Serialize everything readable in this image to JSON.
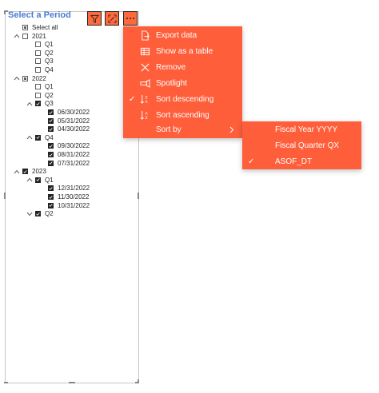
{
  "slicer": {
    "title": "Select a Period",
    "select_all": "Select all",
    "years": [
      {
        "label": "2021",
        "state": "unchecked",
        "expanded": true,
        "quarters": [
          {
            "label": "Q1",
            "state": "unchecked",
            "dates": []
          },
          {
            "label": "Q2",
            "state": "unchecked",
            "dates": []
          },
          {
            "label": "Q3",
            "state": "unchecked",
            "dates": []
          },
          {
            "label": "Q4",
            "state": "unchecked",
            "dates": []
          }
        ]
      },
      {
        "label": "2022",
        "state": "partial",
        "expanded": true,
        "quarters": [
          {
            "label": "Q1",
            "state": "unchecked",
            "dates": []
          },
          {
            "label": "Q2",
            "state": "unchecked",
            "dates": []
          },
          {
            "label": "Q3",
            "state": "checked",
            "expanded": true,
            "dates": [
              "06/30/2022",
              "05/31/2022",
              "04/30/2022"
            ]
          },
          {
            "label": "Q4",
            "state": "checked",
            "expanded": true,
            "dates": [
              "09/30/2022",
              "08/31/2022",
              "07/31/2022"
            ]
          }
        ]
      },
      {
        "label": "2023",
        "state": "checked",
        "expanded": true,
        "quarters": [
          {
            "label": "Q1",
            "state": "checked",
            "expanded": true,
            "dates": [
              "12/31/2022",
              "11/30/2022",
              "10/31/2022"
            ]
          },
          {
            "label": "Q2",
            "state": "checked",
            "expanded": false,
            "dates": []
          }
        ]
      }
    ]
  },
  "header_buttons": [
    {
      "icon": "filter-icon"
    },
    {
      "icon": "focus-mode-icon"
    },
    {
      "icon": "more-options-icon"
    }
  ],
  "context_menu": {
    "items": [
      {
        "label": "Export data",
        "icon": "export-data-icon",
        "checked": false
      },
      {
        "label": "Show as a table",
        "icon": "table-icon",
        "checked": false
      },
      {
        "label": "Remove",
        "icon": "close-icon",
        "checked": false
      },
      {
        "label": "Spotlight",
        "icon": "spotlight-icon",
        "checked": false
      },
      {
        "label": "Sort descending",
        "icon": "sort-descending-icon",
        "checked": true
      },
      {
        "label": "Sort ascending",
        "icon": "sort-ascending-icon",
        "checked": false
      },
      {
        "label": "Sort by",
        "icon": "",
        "checked": false,
        "submenu": true
      }
    ]
  },
  "sort_by_submenu": {
    "items": [
      {
        "label": "Fiscal Year YYYY",
        "checked": false
      },
      {
        "label": "Fiscal Quarter QX",
        "checked": false
      },
      {
        "label": "ASOF_DT",
        "checked": true
      }
    ]
  },
  "colors": {
    "accent": "#ff5e3a",
    "title": "#4a7ad1",
    "text": "#252423"
  }
}
